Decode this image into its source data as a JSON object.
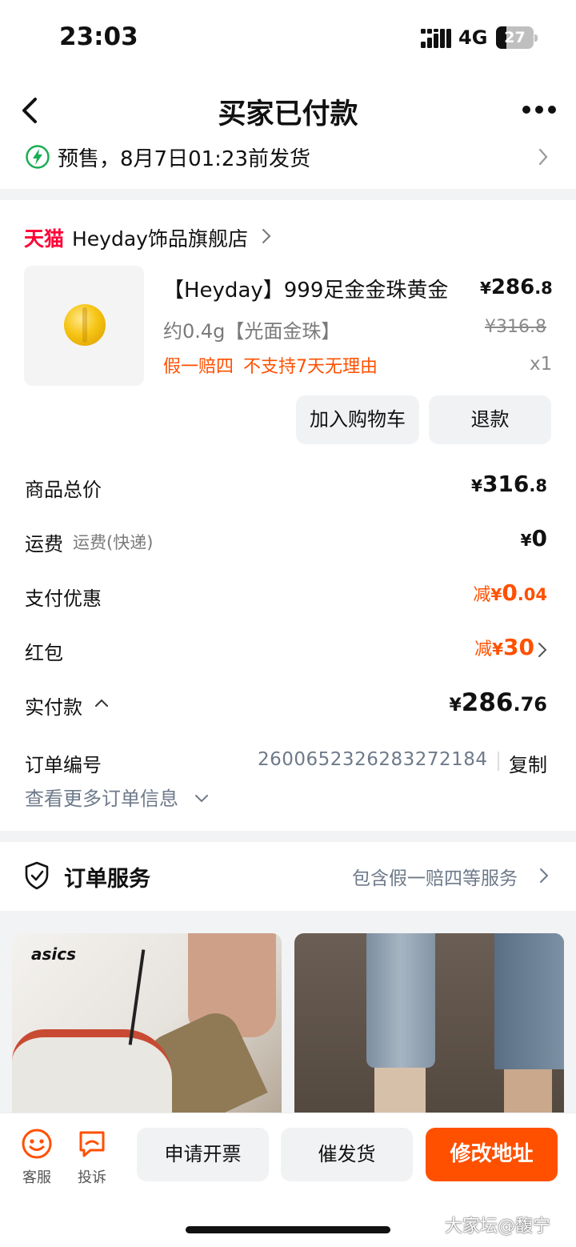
{
  "status_bar": {
    "time": "23:03",
    "network": "4G",
    "battery": "27"
  },
  "nav": {
    "title": "买家已付款"
  },
  "shipping": {
    "text": "预售，8月7日01:23前发货"
  },
  "store": {
    "platform": "天猫",
    "name": "Heyday饰品旗舰店"
  },
  "product": {
    "title": "【Heyday】999足金金珠黄金",
    "price_int": "286",
    "price_dec": ".8",
    "currency": "¥",
    "spec": "约0.4g【光面金珠】",
    "original_price": "¥316.8",
    "tags": [
      "假一赔四",
      "不支持7天无理由"
    ],
    "quantity": "x1"
  },
  "actions": {
    "add_cart": "加入购物车",
    "refund": "退款"
  },
  "summary": {
    "total_label": "商品总价",
    "total_int": "316",
    "total_dec": ".8",
    "shipping_label": "运费",
    "shipping_sub": "运费(快递)",
    "shipping_value": "0",
    "pay_discount_label": "支付优惠",
    "pay_discount_prefix": "减",
    "pay_discount_int": "0",
    "pay_discount_dec": ".04",
    "redpacket_label": "红包",
    "redpacket_prefix": "减",
    "redpacket_value": "30",
    "paid_label": "实付款",
    "paid_int": "286",
    "paid_dec": ".76"
  },
  "order": {
    "number_label": "订单编号",
    "number": "2600652326283272184",
    "copy": "复制",
    "more": "查看更多订单信息"
  },
  "service": {
    "title": "订单服务",
    "desc": "包含假一赔四等服务"
  },
  "recommend": {
    "brand_logo": "asics"
  },
  "bottom_bar": {
    "service_label": "客服",
    "complain_label": "投诉",
    "invoice": "申请开票",
    "urge": "催发货",
    "modify_address": "修改地址"
  },
  "watermark": "大家坛@馥宁",
  "colors": {
    "accent": "#ff5000",
    "tmall": "#ff0036",
    "green": "#1aad53",
    "muted": "#6e7a8a"
  }
}
